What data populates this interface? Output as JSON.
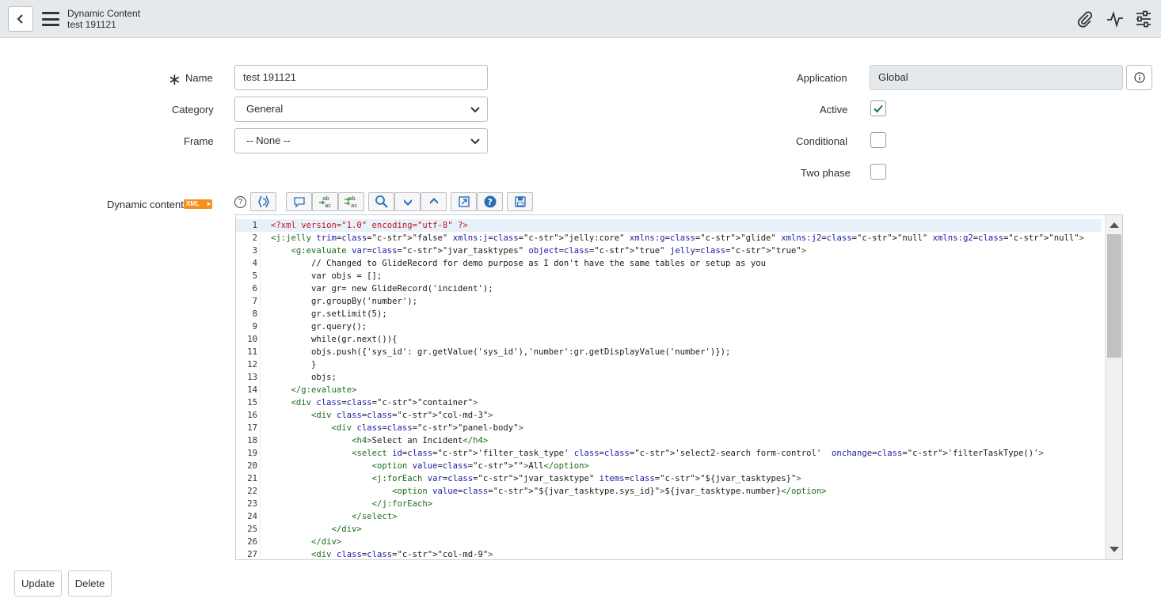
{
  "header": {
    "title": "Dynamic Content",
    "subtitle": "test 191121",
    "icons": [
      "chevron-left-icon",
      "hamburger-menu-icon",
      "paperclip-icon",
      "activity-pulse-icon",
      "settings-sliders-icon"
    ]
  },
  "form": {
    "name": {
      "label": "Name",
      "value": "test 191121",
      "required_mark": "∗"
    },
    "category": {
      "label": "Category",
      "value": "General"
    },
    "frame": {
      "label": "Frame",
      "value": "-- None --"
    },
    "application": {
      "label": "Application",
      "value": "Global"
    },
    "active": {
      "label": "Active",
      "checked": true
    },
    "conditional": {
      "label": "Conditional",
      "checked": false
    },
    "two_phase": {
      "label": "Two phase",
      "checked": false
    },
    "dynamic_content": {
      "label": "Dynamic content",
      "badge": "XML",
      "help": "?"
    }
  },
  "toolbar": {
    "buttons": [
      "format-code-icon",
      "comment-icon",
      "replace-icon",
      "replace-all-icon",
      "search-icon",
      "find-next-icon",
      "find-previous-icon",
      "fullscreen-icon",
      "help-icon",
      "save-icon"
    ]
  },
  "editor": {
    "lines": [
      {
        "n": "1",
        "code": "<?xml version=\"1.0\" encoding=\"utf-8\" ?>"
      },
      {
        "n": "2",
        "code": "<j:jelly trim=\"false\" xmlns:j=\"jelly:core\" xmlns:g=\"glide\" xmlns:j2=\"null\" xmlns:g2=\"null\">"
      },
      {
        "n": "3",
        "code": "    <g:evaluate var=\"jvar_tasktypes\" object=\"true\" jelly=\"true\">"
      },
      {
        "n": "4",
        "code": "        // Changed to GlideRecord for demo purpose as I don't have the same tables or setup as you"
      },
      {
        "n": "5",
        "code": "        var objs = [];"
      },
      {
        "n": "6",
        "code": "        var gr= new GlideRecord('incident');"
      },
      {
        "n": "7",
        "code": "        gr.groupBy('number');"
      },
      {
        "n": "8",
        "code": "        gr.setLimit(5);"
      },
      {
        "n": "9",
        "code": "        gr.query();"
      },
      {
        "n": "10",
        "code": "        while(gr.next()){"
      },
      {
        "n": "11",
        "code": "        objs.push({'sys_id': gr.getValue('sys_id'),'number':gr.getDisplayValue('number')});"
      },
      {
        "n": "12",
        "code": "        }"
      },
      {
        "n": "13",
        "code": "        objs;"
      },
      {
        "n": "14",
        "code": "    </g:evaluate>"
      },
      {
        "n": "15",
        "code": "    <div class=\"container\">"
      },
      {
        "n": "16",
        "code": "        <div class=\"col-md-3\">"
      },
      {
        "n": "17",
        "code": "            <div class=\"panel-body\">"
      },
      {
        "n": "18",
        "code": "                <h4>Select an Incident</h4>"
      },
      {
        "n": "19",
        "code": "                <select id='filter_task_type' class='select2-search form-control'  onchange='filterTaskType()'>"
      },
      {
        "n": "20",
        "code": "                    <option value=\"\">All</option>"
      },
      {
        "n": "21",
        "code": "                    <j:forEach var=\"jvar_tasktype\" items=\"${jvar_tasktypes}\">"
      },
      {
        "n": "22",
        "code": "                        <option value=\"${jvar_tasktype.sys_id}\">${jvar_tasktype.number}</option>"
      },
      {
        "n": "23",
        "code": "                    </j:forEach>"
      },
      {
        "n": "24",
        "code": "                </select>"
      },
      {
        "n": "25",
        "code": "            </div>"
      },
      {
        "n": "26",
        "code": "        </div>"
      },
      {
        "n": "27",
        "code": "        <div class=\"col-md-9\">"
      }
    ]
  },
  "actions": {
    "update": "Update",
    "delete": "Delete"
  }
}
